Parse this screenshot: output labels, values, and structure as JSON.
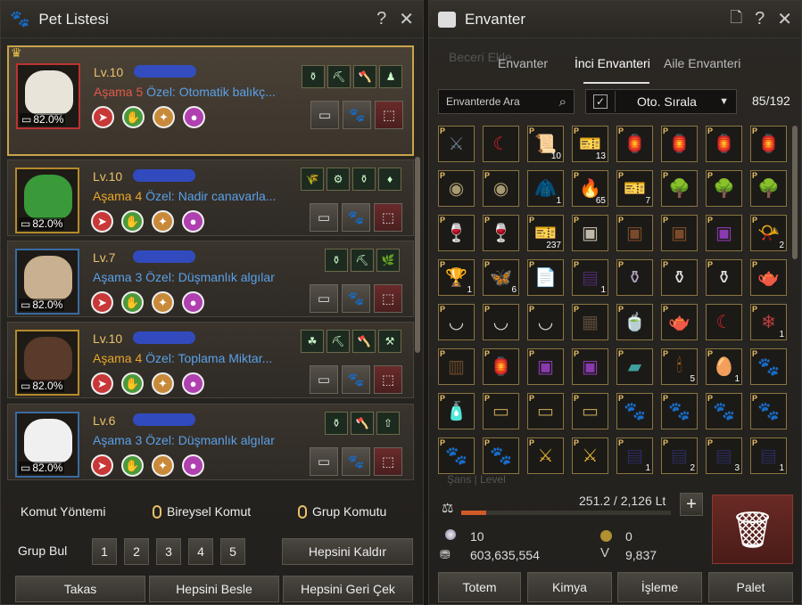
{
  "pet_panel": {
    "title": "Pet Listesi",
    "help": "?",
    "close": "✕",
    "pets": [
      {
        "level": "Lv.10",
        "stage": "Aşama 5",
        "special": "Özel: Otomatik balıkç...",
        "percent": "82.0%",
        "stage_color": "red",
        "border": "red",
        "skills": [
          "⚱",
          "⛏",
          "🪓",
          "♟"
        ]
      },
      {
        "level": "Lv.10",
        "stage": "Aşama 4",
        "special": "Özel: Nadir canavarla...",
        "percent": "82.0%",
        "stage_color": "gold",
        "border": "gold",
        "skills": [
          "🌾",
          "⚙",
          "⚱",
          "♦"
        ]
      },
      {
        "level": "Lv.7",
        "stage": "Aşama 3",
        "special": "Özel: Düşmanlık algılar",
        "percent": "82.0%",
        "stage_color": "blue",
        "border": "blue",
        "skills": [
          "⚱",
          "⛏",
          "🌿"
        ]
      },
      {
        "level": "Lv.10",
        "stage": "Aşama 4",
        "special": "Özel: Toplama Miktar...",
        "percent": "82.0%",
        "stage_color": "gold",
        "border": "gold",
        "skills": [
          "☘",
          "⛏",
          "🪓",
          "⚒"
        ]
      },
      {
        "level": "Lv.6",
        "stage": "Aşama 3",
        "special": "Özel: Düşmanlık algılar",
        "percent": "82.0%",
        "stage_color": "blue",
        "border": "blue",
        "skills": [
          "⚱",
          "🪓",
          "⇧"
        ]
      }
    ],
    "command_method": "Komut Yöntemi",
    "individual_command": "Bireysel Komut",
    "group_command": "Grup Komutu",
    "group_find": "Grup Bul",
    "groups": [
      "1",
      "2",
      "3",
      "4",
      "5"
    ],
    "remove_all": "Hepsini Kaldır",
    "trade": "Takas",
    "feed_all": "Hepsini Besle",
    "recall_all": "Hepsini Geri Çek"
  },
  "inventory": {
    "title": "Envanter",
    "ghost_tab": "Beceri Ekle",
    "tabs": [
      "Envanter",
      "İnci Envanteri",
      "Aile Envanteri"
    ],
    "search_placeholder": "Envanterde Ara",
    "auto_sort": "Oto. Sırala",
    "slots": "85/192",
    "weight": "251.2 / 2,126 Lt",
    "pearls": "10",
    "silver": "603,635,554",
    "coin": "0",
    "valor": "9,837",
    "ghost_footer": "Şans | Level",
    "buttons": [
      "Totem",
      "Kimya",
      "İşleme",
      "Palet"
    ],
    "items": [
      {
        "icon": "⚔",
        "color": "#6a7a8a",
        "p": true,
        "n": ""
      },
      {
        "icon": "☾",
        "color": "#d0202a",
        "p": false,
        "n": ""
      },
      {
        "icon": "📜",
        "color": "#a89060",
        "p": true,
        "n": "10"
      },
      {
        "icon": "🎫",
        "color": "#ccc",
        "p": true,
        "n": "13"
      },
      {
        "icon": "🏮",
        "color": "#c84030",
        "p": true,
        "n": ""
      },
      {
        "icon": "🏮",
        "color": "#c84030",
        "p": true,
        "n": ""
      },
      {
        "icon": "🏮",
        "color": "#c84030",
        "p": true,
        "n": ""
      },
      {
        "icon": "🏮",
        "color": "#c84030",
        "p": true,
        "n": ""
      },
      {
        "icon": "◉",
        "color": "#a89a70",
        "p": true,
        "n": ""
      },
      {
        "icon": "◉",
        "color": "#a89a70",
        "p": true,
        "n": ""
      },
      {
        "icon": "🧥",
        "color": "#7a8a9a",
        "p": false,
        "n": "1"
      },
      {
        "icon": "🔥",
        "color": "#c05020",
        "p": true,
        "n": "65"
      },
      {
        "icon": "🎫",
        "color": "#ccc",
        "p": true,
        "n": "7"
      },
      {
        "icon": "🌳",
        "color": "#aaa",
        "p": true,
        "n": ""
      },
      {
        "icon": "🌳",
        "color": "#aaa",
        "p": true,
        "n": ""
      },
      {
        "icon": "🌳",
        "color": "#aaa",
        "p": true,
        "n": ""
      },
      {
        "icon": "🍷",
        "color": "#3a9ad0",
        "p": true,
        "n": ""
      },
      {
        "icon": "🍷",
        "color": "#c03aa0",
        "p": true,
        "n": ""
      },
      {
        "icon": "🎫",
        "color": "#ccc",
        "p": true,
        "n": "237"
      },
      {
        "icon": "▣",
        "color": "#c0b8a8",
        "p": true,
        "n": ""
      },
      {
        "icon": "▣",
        "color": "#7a4a2a",
        "p": true,
        "n": ""
      },
      {
        "icon": "▣",
        "color": "#7a4a2a",
        "p": true,
        "n": ""
      },
      {
        "icon": "▣",
        "color": "#8a3ab0",
        "p": true,
        "n": ""
      },
      {
        "icon": "📯",
        "color": "#d0b040",
        "p": true,
        "n": "2"
      },
      {
        "icon": "🏆",
        "color": "#b08a30",
        "p": true,
        "n": "1"
      },
      {
        "icon": "🦋",
        "color": "#e0c020",
        "p": true,
        "n": "6"
      },
      {
        "icon": "📄",
        "color": "#ccc",
        "p": true,
        "n": ""
      },
      {
        "icon": "▤",
        "color": "#4a2a6a",
        "p": true,
        "n": "1"
      },
      {
        "icon": "⚱",
        "color": "#b0a0c0",
        "p": true,
        "n": ""
      },
      {
        "icon": "⚱",
        "color": "#ddd",
        "p": true,
        "n": ""
      },
      {
        "icon": "⚱",
        "color": "#ddd",
        "p": true,
        "n": ""
      },
      {
        "icon": "🫖",
        "color": "#aaa",
        "p": true,
        "n": ""
      },
      {
        "icon": "◡",
        "color": "#ddd",
        "p": true,
        "n": ""
      },
      {
        "icon": "◡",
        "color": "#ddd",
        "p": true,
        "n": ""
      },
      {
        "icon": "◡",
        "color": "#ddd",
        "p": true,
        "n": ""
      },
      {
        "icon": "▦",
        "color": "#5a4a3a",
        "p": true,
        "n": ""
      },
      {
        "icon": "🍵",
        "color": "#ccc",
        "p": true,
        "n": ""
      },
      {
        "icon": "🫖",
        "color": "#ccc",
        "p": true,
        "n": ""
      },
      {
        "icon": "☾",
        "color": "#d0202a",
        "p": false,
        "n": ""
      },
      {
        "icon": "❄",
        "color": "#c04040",
        "p": true,
        "n": "1"
      },
      {
        "icon": "▥",
        "color": "#6a4a2a",
        "p": true,
        "n": ""
      },
      {
        "icon": "🏮",
        "color": "#c84030",
        "p": true,
        "n": ""
      },
      {
        "icon": "▣",
        "color": "#8a3ab0",
        "p": true,
        "n": ""
      },
      {
        "icon": "▣",
        "color": "#8a3ab0",
        "p": true,
        "n": ""
      },
      {
        "icon": "▰",
        "color": "#40a0a0",
        "p": true,
        "n": ""
      },
      {
        "icon": "🕯",
        "color": "#c07020",
        "p": true,
        "n": "5"
      },
      {
        "icon": "🥚",
        "color": "#a080c0",
        "p": true,
        "n": "1"
      },
      {
        "icon": "🐾",
        "color": "#c8b090",
        "p": true,
        "n": ""
      },
      {
        "icon": "🧴",
        "color": "#3050b0",
        "p": true,
        "n": ""
      },
      {
        "icon": "▭",
        "color": "#c0a050",
        "p": true,
        "n": ""
      },
      {
        "icon": "▭",
        "color": "#c0a050",
        "p": true,
        "n": ""
      },
      {
        "icon": "▭",
        "color": "#c0a050",
        "p": true,
        "n": ""
      },
      {
        "icon": "🐾",
        "color": "#a8c080",
        "p": true,
        "n": ""
      },
      {
        "icon": "🐾",
        "color": "#a8c080",
        "p": true,
        "n": ""
      },
      {
        "icon": "🐾",
        "color": "#a8c080",
        "p": true,
        "n": ""
      },
      {
        "icon": "🐾",
        "color": "#a8c080",
        "p": true,
        "n": ""
      },
      {
        "icon": "🐾",
        "color": "#a8c080",
        "p": true,
        "n": ""
      },
      {
        "icon": "🐾",
        "color": "#a8c080",
        "p": true,
        "n": ""
      },
      {
        "icon": "⚔",
        "color": "#e0b030",
        "p": true,
        "n": ""
      },
      {
        "icon": "⚔",
        "color": "#e0b030",
        "p": true,
        "n": ""
      },
      {
        "icon": "▤",
        "color": "#2a2a5a",
        "p": true,
        "n": "1"
      },
      {
        "icon": "▤",
        "color": "#2a2a5a",
        "p": true,
        "n": "2"
      },
      {
        "icon": "▤",
        "color": "#2a2a5a",
        "p": true,
        "n": "3"
      },
      {
        "icon": "▤",
        "color": "#2a2a5a",
        "p": true,
        "n": "1"
      }
    ]
  }
}
